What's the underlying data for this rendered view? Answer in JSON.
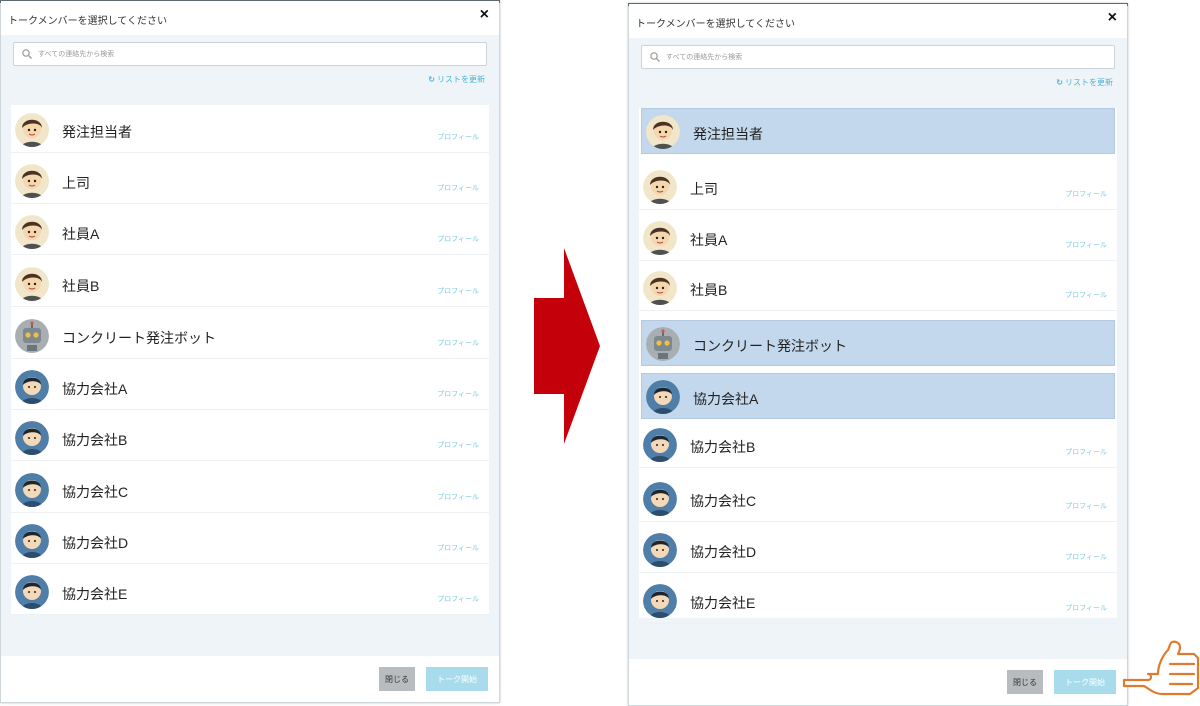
{
  "left": {
    "title": "トークメンバーを選択してください",
    "close": "×",
    "search_placeholder": "すべての連絡先から検索",
    "refresh": "リストを更新",
    "members": [
      {
        "name": "発注担当者",
        "profile": "プロフィール",
        "avatar": "person-brown"
      },
      {
        "name": "上司",
        "profile": "プロフィール",
        "avatar": "person-brown"
      },
      {
        "name": "社員A",
        "profile": "プロフィール",
        "avatar": "person-brown"
      },
      {
        "name": "社員B",
        "profile": "プロフィール",
        "avatar": "person-brown"
      },
      {
        "name": "コンクリート発注ボット",
        "profile": "プロフィール",
        "avatar": "robot"
      },
      {
        "name": "協力会社A",
        "profile": "プロフィール",
        "avatar": "person-blue"
      },
      {
        "name": "協力会社B",
        "profile": "プロフィール",
        "avatar": "person-blue"
      },
      {
        "name": "協力会社C",
        "profile": "プロフィール",
        "avatar": "person-blue"
      },
      {
        "name": "協力会社D",
        "profile": "プロフィール",
        "avatar": "person-blue"
      },
      {
        "name": "協力会社E",
        "profile": "プロフィール",
        "avatar": "person-blue"
      }
    ],
    "buttons": {
      "close": "閉じる",
      "start": "トーク開始"
    }
  },
  "right": {
    "title": "トークメンバーを選択してください",
    "close": "×",
    "search_placeholder": "すべての連絡先から検索",
    "refresh": "リストを更新",
    "members": [
      {
        "name": "発注担当者",
        "profile": "",
        "avatar": "person-brown",
        "selected": true
      },
      {
        "name": "上司",
        "profile": "プロフィール",
        "avatar": "person-brown",
        "selected": false
      },
      {
        "name": "社員A",
        "profile": "プロフィール",
        "avatar": "person-brown",
        "selected": false
      },
      {
        "name": "社員B",
        "profile": "プロフィール",
        "avatar": "person-brown",
        "selected": false
      },
      {
        "name": "コンクリート発注ボット",
        "profile": "",
        "avatar": "robot",
        "selected": true
      },
      {
        "name": "協力会社A",
        "profile": "",
        "avatar": "person-blue",
        "selected": true
      },
      {
        "name": "協力会社B",
        "profile": "プロフィール",
        "avatar": "person-blue",
        "selected": false
      },
      {
        "name": "協力会社C",
        "profile": "プロフィール",
        "avatar": "person-blue",
        "selected": false
      },
      {
        "name": "協力会社D",
        "profile": "プロフィール",
        "avatar": "person-blue",
        "selected": false
      },
      {
        "name": "協力会社E",
        "profile": "プロフィール",
        "avatar": "person-blue",
        "selected": false
      }
    ],
    "buttons": {
      "close": "閉じる",
      "start": "トーク開始"
    }
  },
  "colors": {
    "selected_row": "#c3d8ec",
    "profile_link": "#7fc9e3",
    "arrow": "#c4000b",
    "hand": "#e07a2e",
    "start_button": "#a8dcec"
  },
  "icons": {
    "arrow": "right-arrow-icon",
    "hand": "pointing-hand-icon",
    "search": "search-icon",
    "refresh": "refresh-icon"
  }
}
